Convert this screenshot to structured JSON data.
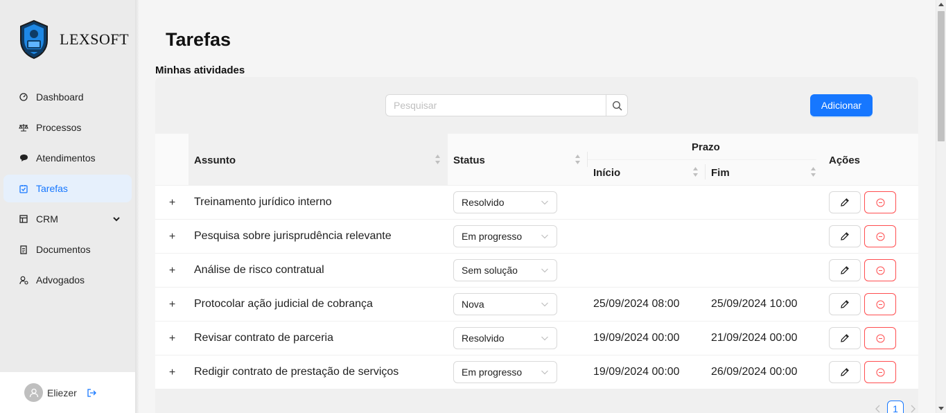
{
  "brand": {
    "name": "LEXSOFT"
  },
  "sidebar": {
    "items": [
      {
        "label": "Dashboard",
        "icon": "dashboard-icon"
      },
      {
        "label": "Processos",
        "icon": "scales-icon"
      },
      {
        "label": "Atendimentos",
        "icon": "chat-icon"
      },
      {
        "label": "Tarefas",
        "icon": "task-icon",
        "active": true
      },
      {
        "label": "CRM",
        "icon": "crm-icon",
        "has_submenu": true
      },
      {
        "label": "Documentos",
        "icon": "documents-icon"
      },
      {
        "label": "Advogados",
        "icon": "lawyers-icon"
      }
    ],
    "user": {
      "name": "Eliezer"
    }
  },
  "main": {
    "title": "Tarefas",
    "section": "Minhas atividades",
    "search": {
      "placeholder": "Pesquisar",
      "value": ""
    },
    "add_label": "Adicionar"
  },
  "table": {
    "columns": {
      "subject": "Assunto",
      "status": "Status",
      "deadline": "Prazo",
      "start": "Início",
      "end": "Fim",
      "actions": "Ações"
    },
    "rows": [
      {
        "subject": "Treinamento jurídico interno",
        "status": "Resolvido",
        "start": "",
        "end": ""
      },
      {
        "subject": "Pesquisa sobre jurisprudência relevante",
        "status": "Em progresso",
        "start": "",
        "end": ""
      },
      {
        "subject": "Análise de risco contratual",
        "status": "Sem solução",
        "start": "",
        "end": ""
      },
      {
        "subject": "Protocolar ação judicial de cobrança",
        "status": "Nova",
        "start": "25/09/2024 08:00",
        "end": "25/09/2024 10:00"
      },
      {
        "subject": "Revisar contrato de parceria",
        "status": "Resolvido",
        "start": "19/09/2024 00:00",
        "end": "21/09/2024 00:00"
      },
      {
        "subject": "Redigir contrato de prestação de serviços",
        "status": "Em progresso",
        "start": "19/09/2024 00:00",
        "end": "26/09/2024 00:00"
      }
    ]
  },
  "pagination": {
    "current": "1"
  },
  "colors": {
    "primary": "#1677ff",
    "danger": "#ff4d4f",
    "active_menu_bg": "#e6f0fc"
  }
}
